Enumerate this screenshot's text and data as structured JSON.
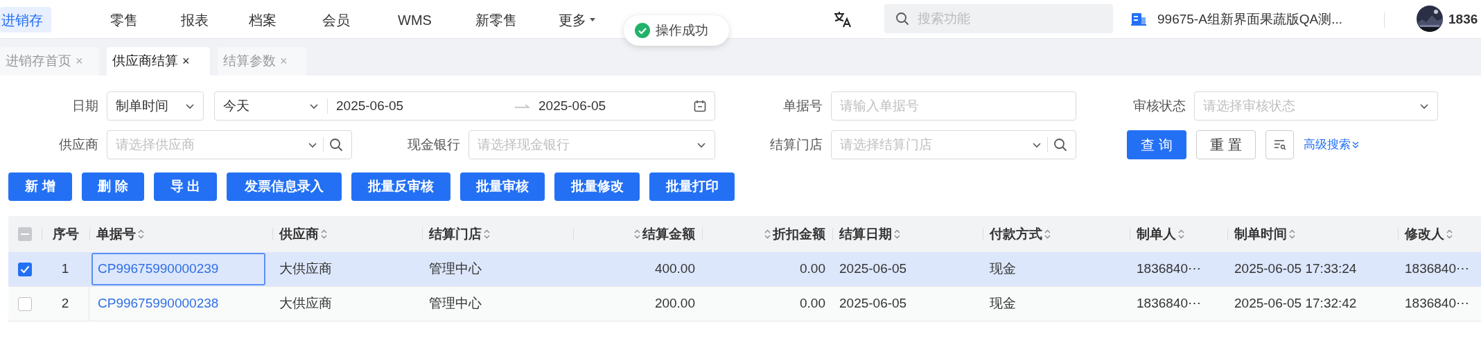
{
  "nav": {
    "items": [
      {
        "label": "进销存",
        "selected": true,
        "dropdown": false
      },
      {
        "label": "零售",
        "selected": false,
        "dropdown": false
      },
      {
        "label": "报表",
        "selected": false,
        "dropdown": false
      },
      {
        "label": "档案",
        "selected": false,
        "dropdown": false
      },
      {
        "label": "会员",
        "selected": false,
        "dropdown": false
      },
      {
        "label": "WMS",
        "selected": false,
        "dropdown": false
      },
      {
        "label": "新零售",
        "selected": false,
        "dropdown": false
      },
      {
        "label": "更多",
        "selected": false,
        "dropdown": true
      }
    ],
    "toast": "操作成功",
    "search": {
      "placeholder": "搜索功能"
    },
    "store": "99675-A组新界面果蔬版QA测...",
    "user": "1836"
  },
  "tabs": [
    {
      "label": "进销存首页",
      "selected": false,
      "close": "×"
    },
    {
      "label": "供应商结算",
      "selected": true,
      "close": "×"
    },
    {
      "label": "结算参数",
      "selected": false,
      "close": "×"
    }
  ],
  "filters": {
    "date": {
      "label": "日期",
      "type": "制单时间",
      "period": "今天",
      "start": "2025-06-05",
      "end": "2025-06-05"
    },
    "doc_no": {
      "label": "单据号",
      "placeholder": "请输入单据号"
    },
    "audit_status": {
      "label": "审核状态",
      "placeholder": "请选择审核状态"
    },
    "supplier": {
      "label": "供应商",
      "placeholder": "请选择供应商"
    },
    "cash_bank": {
      "label": "现金银行",
      "placeholder": "请选择现金银行"
    },
    "store": {
      "label": "结算门店",
      "placeholder": "请选择结算门店"
    },
    "query": "查 询",
    "reset": "重 置",
    "advanced": "高级搜索"
  },
  "actions": [
    "新 增",
    "删 除",
    "导 出",
    "发票信息录入",
    "批量反审核",
    "批量审核",
    "批量修改",
    "批量打印"
  ],
  "table": {
    "select_all": {
      "indeterminate": true
    },
    "columns": [
      {
        "label": "序号",
        "sortable": false,
        "kind": "index"
      },
      {
        "label": "单据号",
        "sortable": true,
        "kind": "link"
      },
      {
        "label": "供应商",
        "sortable": true,
        "kind": "text"
      },
      {
        "label": "结算门店",
        "sortable": true,
        "kind": "text"
      },
      {
        "label": "结算金额",
        "sortable": true,
        "kind": "number"
      },
      {
        "label": "折扣金额",
        "sortable": true,
        "kind": "number"
      },
      {
        "label": "结算日期",
        "sortable": true,
        "kind": "text"
      },
      {
        "label": "付款方式",
        "sortable": true,
        "kind": "text"
      },
      {
        "label": "制单人",
        "sortable": true,
        "kind": "text"
      },
      {
        "label": "制单时间",
        "sortable": true,
        "kind": "text"
      },
      {
        "label": "修改人",
        "sortable": true,
        "kind": "text"
      }
    ],
    "rows": [
      {
        "selected": true,
        "focused": true,
        "cells": [
          "1",
          "CP99675990000239",
          "大供应商",
          "管理中心",
          "400.00",
          "0.00",
          "2025-06-05",
          "现金",
          "1836840⋯",
          "2025-06-05 17:33:24",
          "1836840⋯"
        ]
      },
      {
        "selected": false,
        "focused": false,
        "cells": [
          "2",
          "CP99675990000238",
          "大供应商",
          "管理中心",
          "200.00",
          "0.00",
          "2025-06-05",
          "现金",
          "1836840⋯",
          "2025-06-05 17:32:42",
          "1836840⋯"
        ]
      }
    ]
  }
}
